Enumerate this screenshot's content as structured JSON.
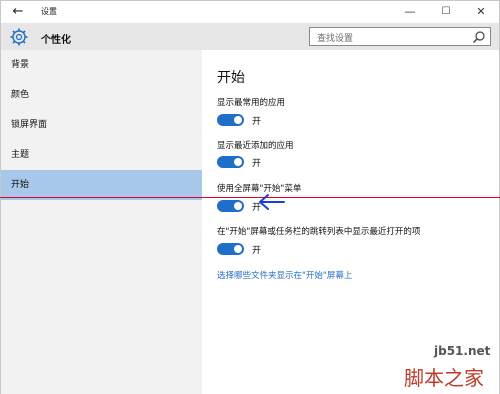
{
  "titlebar": {
    "title": "设置",
    "back_icon": "back-arrow-icon",
    "min_glyph": "—",
    "max_glyph": "☐",
    "close_glyph": "✕"
  },
  "header": {
    "title": "个性化",
    "icon": "gear-icon",
    "search_placeholder": "查找设置"
  },
  "sidebar": {
    "items": [
      {
        "label": "背景",
        "active": false
      },
      {
        "label": "颜色",
        "active": false
      },
      {
        "label": "锁屏界面",
        "active": false
      },
      {
        "label": "主题",
        "active": false
      },
      {
        "label": "开始",
        "active": true
      }
    ]
  },
  "main": {
    "title": "开始",
    "options": [
      {
        "label": "显示最常用的应用",
        "state": "开",
        "on": true
      },
      {
        "label": "显示最近添加的应用",
        "state": "开",
        "on": true
      },
      {
        "label": "使用全屏幕\"开始\"菜单",
        "state": "开",
        "on": true
      },
      {
        "label": "在\"开始\"屏幕或任务栏的跳转列表中显示最近打开的项",
        "state": "开",
        "on": true
      }
    ],
    "link": "选择哪些文件夹显示在\"开始\"屏幕上"
  },
  "annotation": {
    "line_color": "#e0002a",
    "arrow_color": "#1a3fd6"
  },
  "watermark": {
    "site": "jb51.net",
    "brand": "脚本之家"
  },
  "colors": {
    "accent": "#1f6fc8",
    "sidebar_bg": "#f2f2f2",
    "sidebar_active": "#a7c8ea",
    "header_bg": "#e6e6e6"
  }
}
